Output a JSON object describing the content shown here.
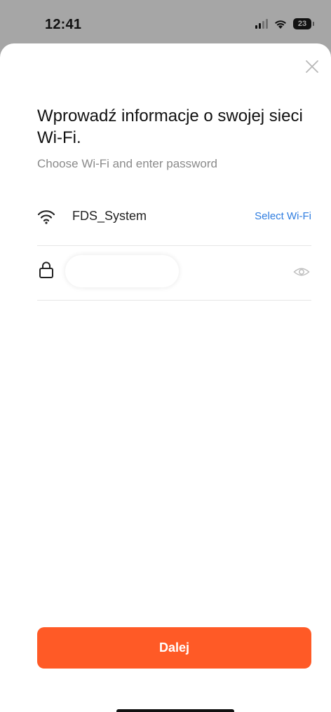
{
  "status_bar": {
    "time": "12:41",
    "battery_level": "23",
    "icons": [
      "signal-icon",
      "wifi-icon",
      "battery-icon"
    ]
  },
  "header": {
    "close_icon": "close-icon",
    "title": "Wprowadź informacje o swojej sieci Wi-Fi.",
    "subtitle": "Choose Wi-Fi and enter password"
  },
  "wifi_row": {
    "icon": "wifi-icon",
    "ssid": "FDS_System",
    "select_label": "Select Wi-Fi"
  },
  "password_row": {
    "icon": "lock-icon",
    "value": "",
    "visibility_icon": "eye-icon"
  },
  "footer": {
    "next_label": "Dalej"
  },
  "colors": {
    "accent": "#ff5a26",
    "link": "#2f7de0",
    "status_bar_bg": "#a6a6a6"
  }
}
